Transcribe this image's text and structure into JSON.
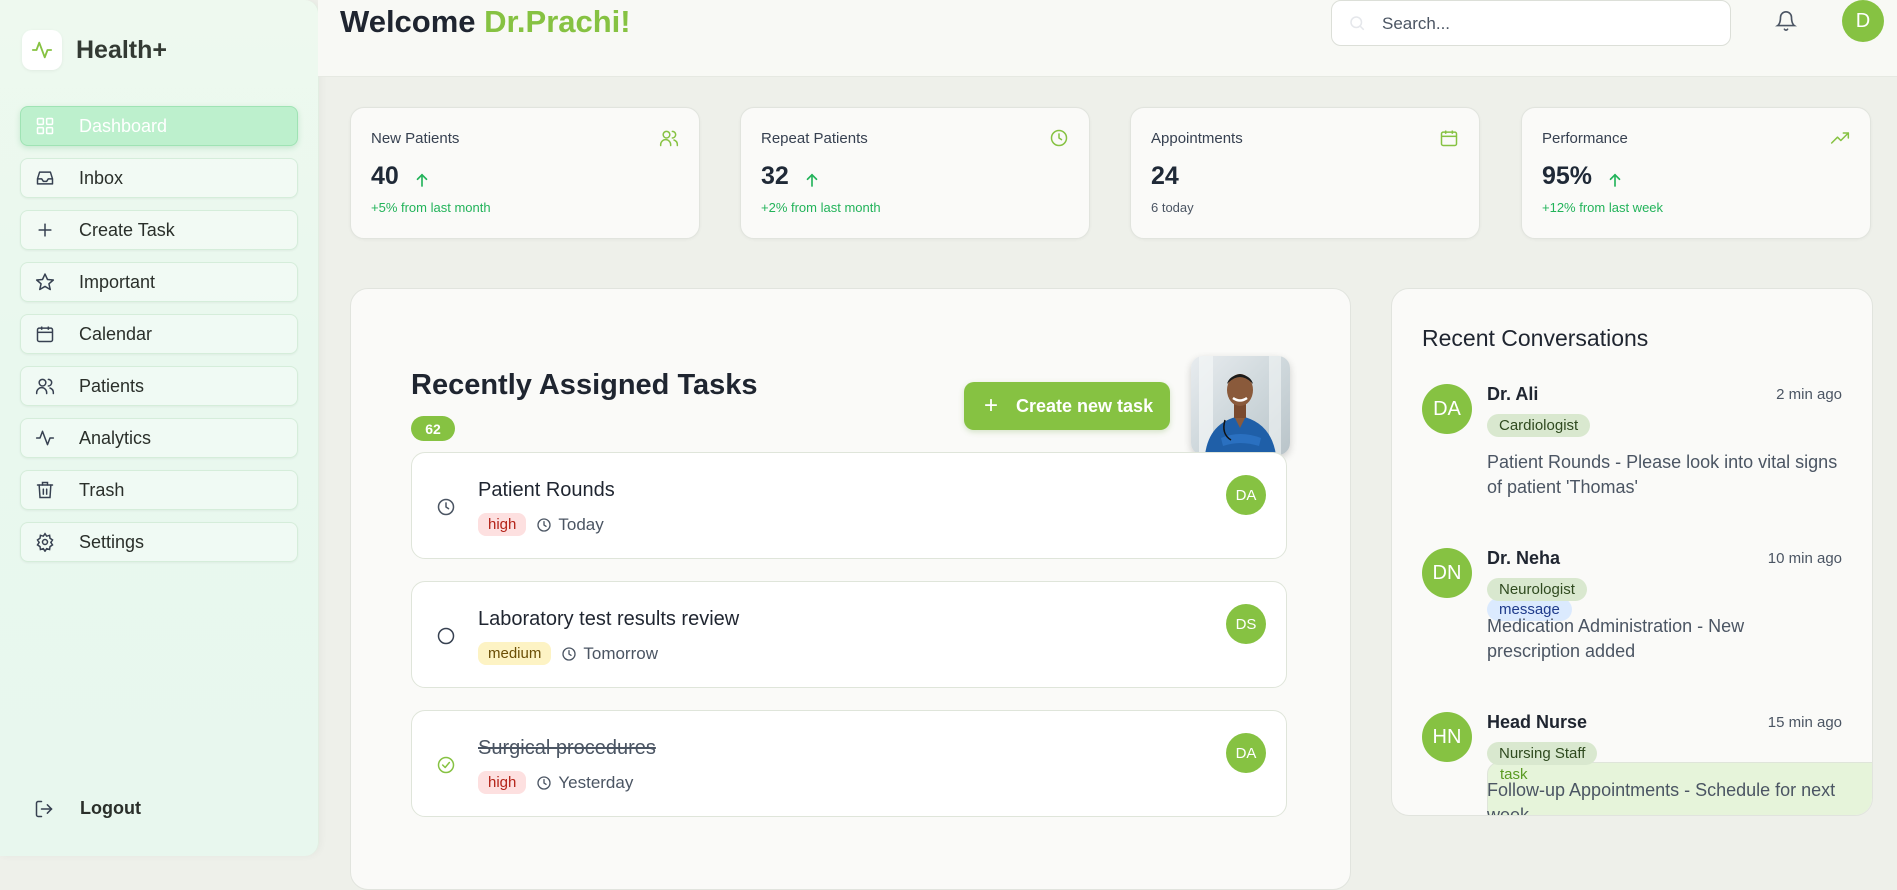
{
  "brand": {
    "name": "Health+"
  },
  "sidebar": {
    "items": [
      {
        "label": "Dashboard",
        "icon": "grid-icon",
        "active": true
      },
      {
        "label": "Inbox",
        "icon": "inbox-icon"
      },
      {
        "label": "Create Task",
        "icon": "plus-icon"
      },
      {
        "label": "Important",
        "icon": "star-icon"
      },
      {
        "label": "Calendar",
        "icon": "calendar-icon"
      },
      {
        "label": "Patients",
        "icon": "users-icon"
      },
      {
        "label": "Analytics",
        "icon": "activity-icon"
      },
      {
        "label": "Trash",
        "icon": "trash-icon"
      },
      {
        "label": "Settings",
        "icon": "gear-icon"
      }
    ],
    "logout_label": "Logout"
  },
  "header": {
    "welcome_prefix": "Welcome",
    "doctor_name": "Dr.Prachi!",
    "search_placeholder": "Search...",
    "avatar_initial": "D"
  },
  "stats": [
    {
      "label": "New Patients",
      "value": "40",
      "sub": "+5% from last month",
      "trend": "up",
      "icon": "users-icon"
    },
    {
      "label": "Repeat Patients",
      "value": "32",
      "sub": "+2% from last month",
      "trend": "up",
      "icon": "clock-icon"
    },
    {
      "label": "Appointments",
      "value": "24",
      "sub": "6 today",
      "icon": "calendar-icon"
    },
    {
      "label": "Performance",
      "value": "95%",
      "sub": "+12% from last week",
      "trend": "up",
      "icon": "trending-up-icon"
    }
  ],
  "tasks": {
    "title": "Recently Assigned Tasks",
    "count": "62",
    "create_label": "Create new task",
    "items": [
      {
        "title": "Patient Rounds",
        "priority": "high",
        "when": "Today",
        "assignee": "DA",
        "status": "pending"
      },
      {
        "title": "Laboratory test results review",
        "priority": "medium",
        "when": "Tomorrow",
        "assignee": "DS",
        "status": "open"
      },
      {
        "title": "Surgical procedures",
        "priority": "high",
        "when": "Yesterday",
        "assignee": "DA",
        "status": "done"
      }
    ]
  },
  "conversations": {
    "title": "Recent Conversations",
    "items": [
      {
        "initials": "DA",
        "name": "Dr. Ali",
        "time": "2 min ago",
        "role": "Cardiologist",
        "text": "Patient Rounds - Please look into vital signs of patient 'Thomas'",
        "tag": "message"
      },
      {
        "initials": "DN",
        "name": "Dr. Neha",
        "time": "10 min ago",
        "role": "Neurologist",
        "text": "Medication Administration - New prescription added",
        "tag": "task"
      },
      {
        "initials": "HN",
        "name": "Head Nurse",
        "time": "15 min ago",
        "role": "Nursing Staff",
        "text": "Follow-up Appointments - Schedule for next week",
        "tag": ""
      }
    ]
  },
  "colors": {
    "accent": "#86c242",
    "positive": "#22b35a",
    "sidebar_active": "#bdf0cd"
  }
}
